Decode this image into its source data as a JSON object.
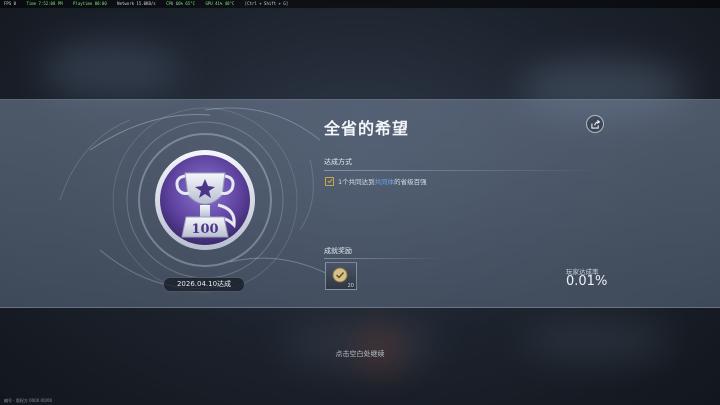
{
  "perf_bar": {
    "fps": "FPS 0",
    "time": "Time 7:52:08 PM",
    "playtime": "Playtime 00:00",
    "network": "Network 15.0KB/s",
    "cpu": "CPU 66% 65°C",
    "gpu": "GPU 41% 48°C",
    "hint": "[Ctrl + Shift + G]"
  },
  "achievement": {
    "title": "全省的希望",
    "medal_number": "100",
    "date_achieved": "2026.04.10达成",
    "method_label": "达成方式",
    "condition_pre": "1个共同达到",
    "condition_highlight": "共同体",
    "condition_post": "的省级百强",
    "reward_label": "成就奖励",
    "reward_count": "20",
    "player_rate_label": "玩家达成率",
    "player_rate_value": "0.01%"
  },
  "continue_hint": "点击空白处继续",
  "footer_text": "编号 · 版权方 0000 00/00",
  "colors": {
    "highlight": "#6ea6e0",
    "check": "#c9a94a",
    "medal_purple": "#6b4fae"
  },
  "icons": {
    "share": "share-icon",
    "check": "checkbox-icon",
    "medal": "trophy-medal-icon",
    "reward": "reward-token-icon"
  }
}
